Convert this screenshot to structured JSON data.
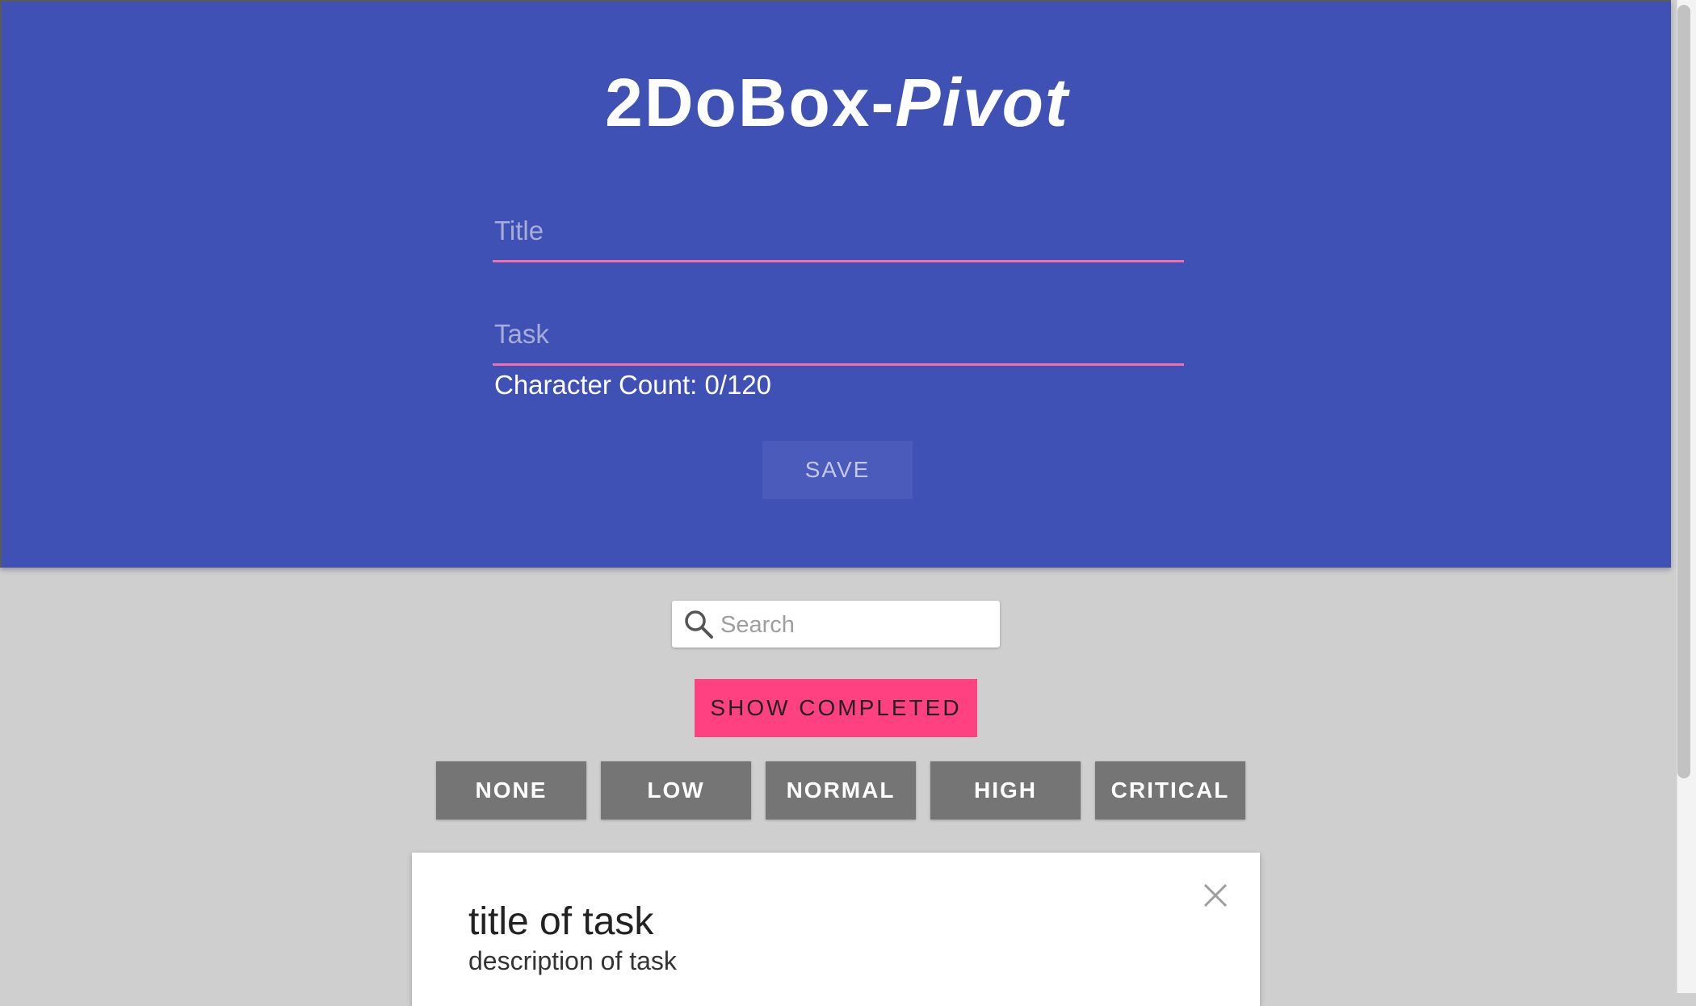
{
  "header": {
    "title_main": "2DoBox-",
    "title_italic": "Pivot"
  },
  "form": {
    "title_placeholder": "Title",
    "task_placeholder": "Task",
    "char_count_label": "Character Count: 0/120",
    "save_label": "SAVE"
  },
  "search": {
    "placeholder": "Search",
    "icon": "search-icon"
  },
  "show_completed_label": "SHOW COMPLETED",
  "filters": [
    {
      "label": "NONE"
    },
    {
      "label": "LOW"
    },
    {
      "label": "NORMAL"
    },
    {
      "label": "HIGH"
    },
    {
      "label": "CRITICAL"
    }
  ],
  "cards": [
    {
      "title": "title of task",
      "description": "description of task",
      "close_icon": "close-icon"
    }
  ],
  "colors": {
    "header_bg": "#3f51b5",
    "accent_pink": "#ff4081",
    "input_underline": "#f06fa8",
    "filter_bg": "#757575",
    "page_bg": "#cfcfcf"
  }
}
